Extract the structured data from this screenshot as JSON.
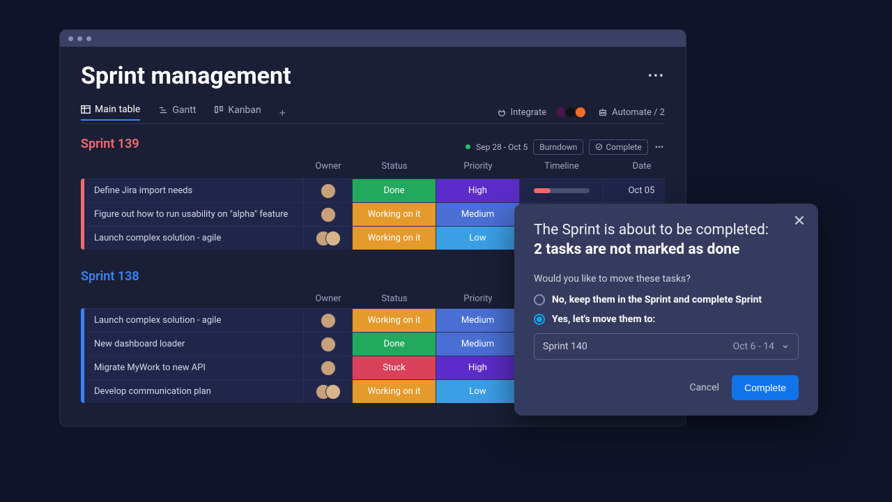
{
  "page": {
    "title": "Sprint management"
  },
  "tabs": {
    "main": "Main table",
    "gantt": "Gantt",
    "kanban": "Kanban"
  },
  "toolbar": {
    "integrate": "Integrate",
    "automate": "Automate / 2"
  },
  "columns": {
    "owner": "Owner",
    "status": "Status",
    "priority": "Priority",
    "timeline": "Timeline",
    "date": "Date"
  },
  "sprint139": {
    "title": "Sprint 139",
    "period": "Sep 28 - Oct 5",
    "burndown": "Burndown",
    "complete": "Complete",
    "rows": [
      {
        "task": "Define Jira import needs",
        "status": "Done",
        "statusClass": "s-done",
        "priority": "High",
        "priorityClass": "p-high",
        "date": "Oct 05",
        "owners": 1
      },
      {
        "task": "Figure out how to run usability on \"alpha\" feature",
        "status": "Working on it",
        "statusClass": "s-working",
        "priority": "Medium",
        "priorityClass": "p-medium",
        "date": "",
        "owners": 1
      },
      {
        "task": "Launch complex solution - agile",
        "status": "Working on it",
        "statusClass": "s-working",
        "priority": "Low",
        "priorityClass": "p-low",
        "date": "",
        "owners": 2
      }
    ]
  },
  "sprint138": {
    "title": "Sprint 138",
    "rows": [
      {
        "task": "Launch complex solution - agile",
        "status": "Working on it",
        "statusClass": "s-working",
        "priority": "Medium",
        "priorityClass": "p-medium",
        "owners": 1
      },
      {
        "task": "New dashboard loader",
        "status": "Done",
        "statusClass": "s-done",
        "priority": "Medium",
        "priorityClass": "p-medium",
        "owners": 1
      },
      {
        "task": "Migrate MyWork to new API",
        "status": "Stuck",
        "statusClass": "s-stuck",
        "priority": "High",
        "priorityClass": "p-high",
        "owners": 1
      },
      {
        "task": "Develop communication plan",
        "status": "Working on it",
        "statusClass": "s-working",
        "priority": "Low",
        "priorityClass": "p-low",
        "owners": 2
      }
    ]
  },
  "modal": {
    "line1": "The Sprint is about to be completed:",
    "line2": "2 tasks are not marked as done",
    "question": "Would you like to move these tasks?",
    "option_no": "No, keep them in the Sprint and complete Sprint",
    "option_yes": "Yes, let's move them to:",
    "select_value": "Sprint 140",
    "select_date": "Oct 6 - 14",
    "cancel": "Cancel",
    "complete": "Complete"
  }
}
